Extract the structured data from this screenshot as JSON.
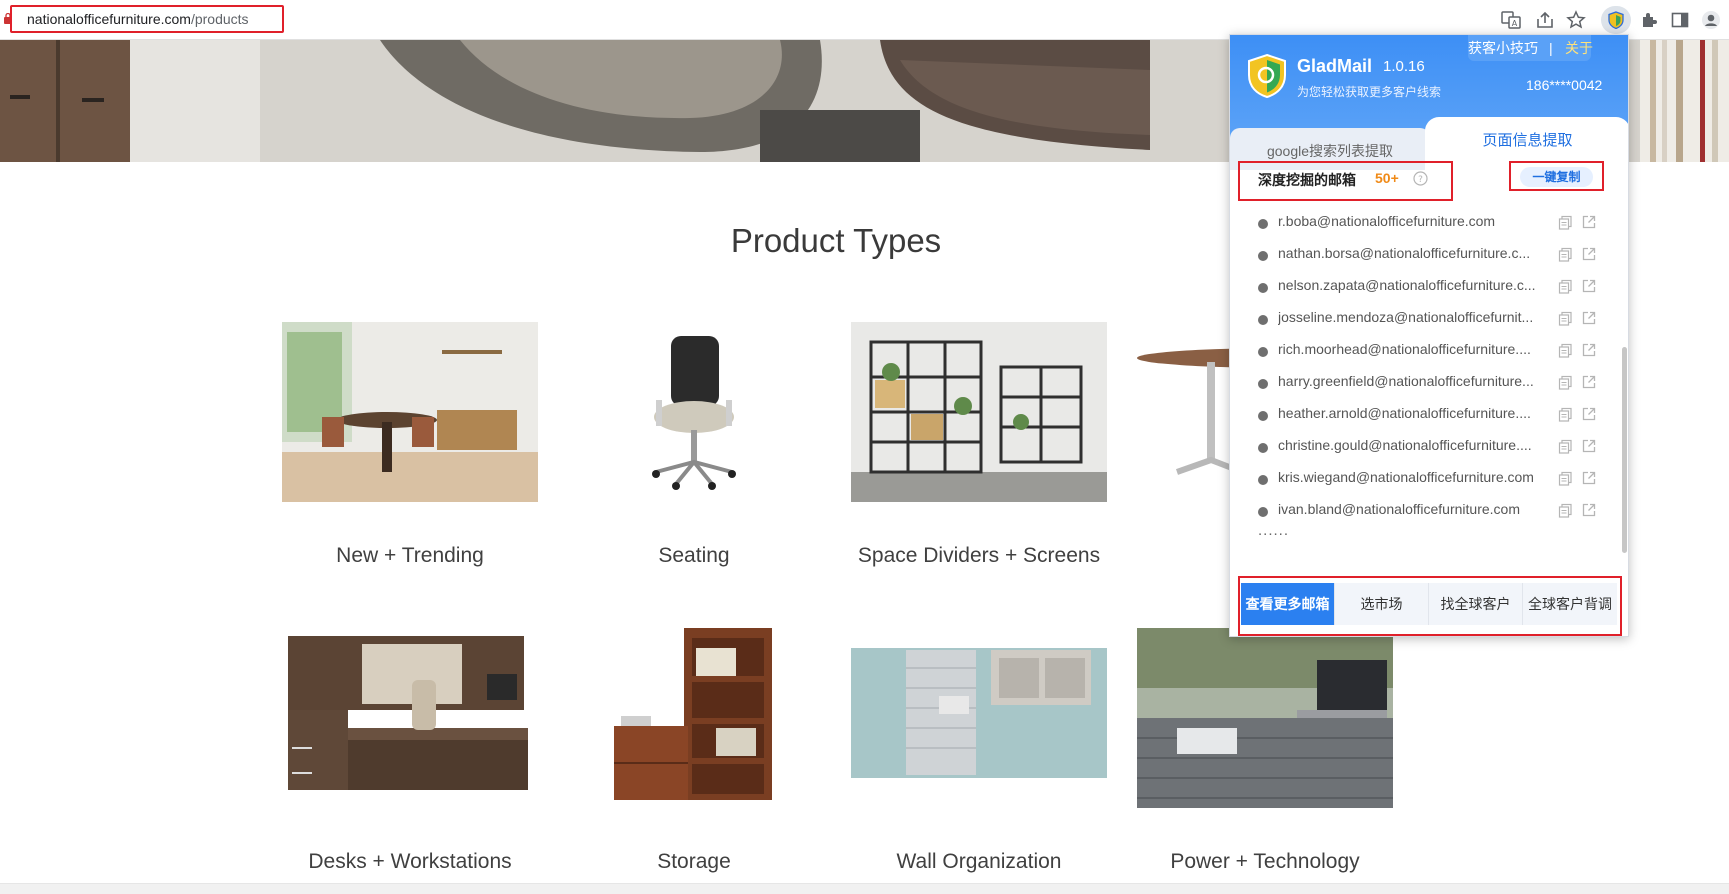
{
  "browser": {
    "url_domain": "nationalofficefurniture.com",
    "url_path": "/products"
  },
  "page": {
    "section_title": "Product Types",
    "products": [
      {
        "label": "New + Trending"
      },
      {
        "label": "Seating"
      },
      {
        "label": "Space Dividers + Screens"
      },
      {
        "label": "Desks + Workstations"
      },
      {
        "label": "Storage"
      },
      {
        "label": "Wall Organization"
      },
      {
        "label": "Power + Technology"
      }
    ]
  },
  "gladmail": {
    "name": "GladMail",
    "version": "1.0.16",
    "tagline": "为您轻松获取更多客户线索",
    "tips_link": "获客小技巧",
    "separator": "|",
    "about_link": "关于",
    "account": "186****0042",
    "tabs": {
      "google": "google搜索列表提取",
      "page": "页面信息提取"
    },
    "mined_title": "深度挖掘的邮箱",
    "mined_count": "50+",
    "copy_all": "一键复制",
    "emails": [
      "r.boba@nationalofficefurniture.com",
      "nathan.borsa@nationalofficefurniture.c...",
      "nelson.zapata@nationalofficefurniture.c...",
      "josseline.mendoza@nationalofficefurnit...",
      "rich.moorhead@nationalofficefurniture....",
      "harry.greenfield@nationalofficefurniture...",
      "heather.arnold@nationalofficefurniture....",
      "christine.gould@nationalofficefurniture....",
      "kris.wiegand@nationalofficefurniture.com",
      "ivan.bland@nationalofficefurniture.com"
    ],
    "ellipsis": "......",
    "actions": {
      "more": "查看更多邮箱",
      "market": "选市场",
      "global_customers": "找全球客户",
      "background": "全球客户背调"
    },
    "colors": {
      "header_blue": "#3d8ff5",
      "accent_orange": "#f08a17",
      "highlight_red": "#e0202a"
    }
  }
}
